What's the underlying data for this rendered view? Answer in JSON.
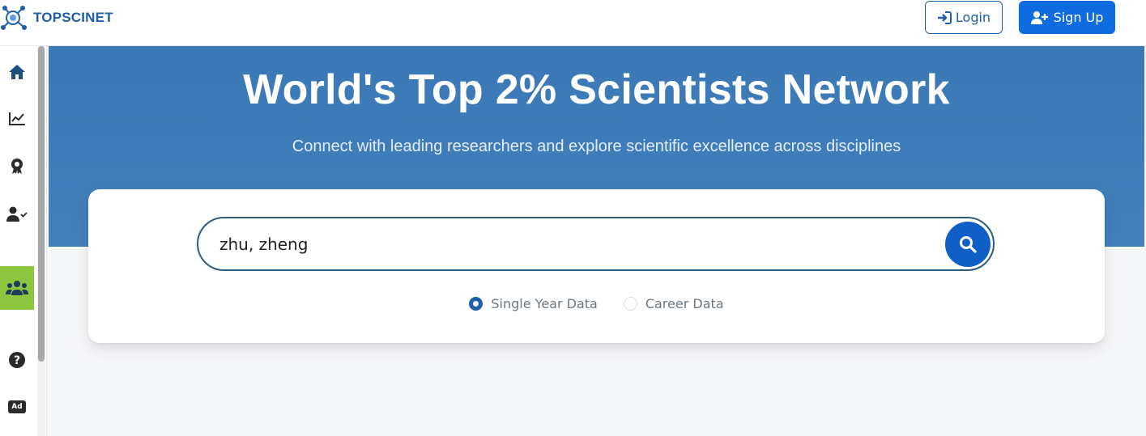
{
  "header": {
    "logo_text": "TOPSCINET",
    "login_label": "Login",
    "signup_label": "Sign Up"
  },
  "sidebar": {
    "items": [
      {
        "icon": "home-icon"
      },
      {
        "icon": "chart-line-icon"
      },
      {
        "icon": "award-icon"
      },
      {
        "icon": "user-check-icon"
      },
      {
        "icon": "users-icon",
        "active": true
      },
      {
        "icon": "question-icon"
      },
      {
        "icon": "ad-icon",
        "label": "Ad"
      }
    ]
  },
  "hero": {
    "title": "World's Top 2% Scientists Network",
    "subtitle": "Connect with leading researchers and explore scientific excellence across disciplines"
  },
  "search": {
    "value": "zhu, zheng",
    "options": [
      {
        "label": "Single Year Data",
        "selected": true
      },
      {
        "label": "Career Data",
        "selected": false
      }
    ]
  },
  "colors": {
    "brand": "#1f5ea8",
    "hero_bg": "#3f7dba",
    "signup_bg": "#0f6be0",
    "active_sidebar": "#8cc63f",
    "search_button": "#0f5fc7"
  }
}
